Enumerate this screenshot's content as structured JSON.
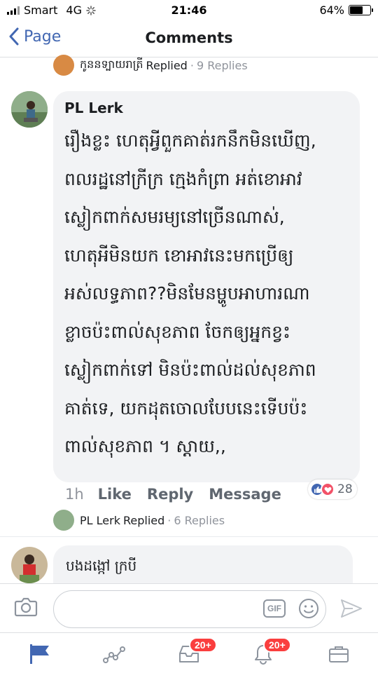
{
  "status_bar": {
    "carrier": "Smart",
    "network": "4G",
    "time": "21:46",
    "battery": "64%",
    "battery_level": 0.64
  },
  "nav": {
    "back_label": "Page",
    "title": "Comments"
  },
  "prev_thread": {
    "replier": "កូននទ្បាយរាត្រី",
    "replied_label": "Replied",
    "separator": "·",
    "count": "9 Replies"
  },
  "comment": {
    "author": "PL Lerk",
    "lines": [
      "រឿងខ្លះ ហេតុអ្វីពួកគាត់រកនឹកមិនឃើញ,",
      "ពលរដ្ឋនៅក្រីក្រ ក្មេងកំព្រា អត់ខោអាវ",
      "ស្លៀកពាក់សមរម្យនៅច្រើនណាស់,",
      "ហេតុអីមិនយក ខោអាវនេះមកប្រើឲ្យ",
      "អស់លទ្ធភាព??មិនមែនម្ហូបអាហារណា",
      "ខ្លាចប៉ះពាល់សុខភាព ចែកឲ្យអ្នកខ្វះ",
      "ស្លៀកពាក់ទៅ មិនប៉ះពាល់ដល់សុខភាព",
      "គាត់ទេ, យកដុតចោលបែបនេះទើបប៉ះ",
      "ពាល់សុខភាព ។ ស្តាយ,,"
    ],
    "time": "1h",
    "like": "Like",
    "reply": "Reply",
    "message": "Message",
    "reaction_count": "28",
    "reaction_icons": [
      "like-icon",
      "love-icon"
    ],
    "reaction_colors": {
      "like": "#4267b2",
      "love": "#f25268"
    }
  },
  "reply_thread": {
    "replier": "PL Lerk",
    "replied_label": "Replied",
    "separator": "·",
    "count": "6 Replies"
  },
  "second_comment": {
    "author": "បងដង្កៅ ក្របី"
  },
  "composer": {
    "gif_label": "GIF",
    "placeholder": ""
  },
  "tabs": [
    {
      "name": "news-feed-icon",
      "badge": ""
    },
    {
      "name": "activity-icon",
      "badge": ""
    },
    {
      "name": "inbox-icon",
      "badge": "20+"
    },
    {
      "name": "notifications-icon",
      "badge": "20+"
    },
    {
      "name": "menu-icon",
      "badge": ""
    }
  ],
  "colors": {
    "accent": "#4267b2",
    "badge": "#fa3e3e",
    "bubble": "#f2f3f5"
  }
}
